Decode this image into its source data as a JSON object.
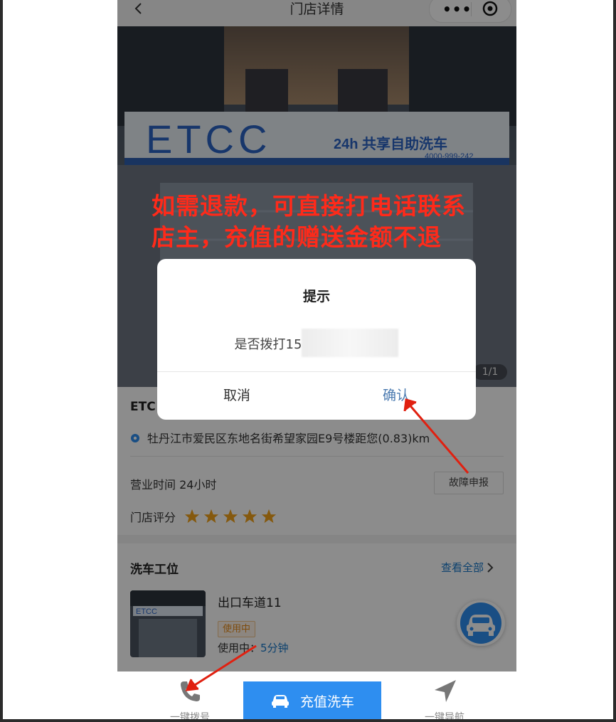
{
  "nav": {
    "title": "门店详情",
    "more_glyph": "•••"
  },
  "banner": {
    "sign_brand": "ETCC",
    "sign_slogan": "24h 共享自助洗车",
    "sign_phone": "4000-999-242",
    "counter": "1/1"
  },
  "annotation": {
    "line1": "如需退款，可直接打电话联系",
    "line2": "店主，充值的赠送金额不退"
  },
  "dialog": {
    "title": "提示",
    "message": "是否拨打15",
    "cancel": "取消",
    "confirm": "确认"
  },
  "store": {
    "name": "ETC",
    "address": "牡丹江市爱民区东地名街希望家园E9号楼距您(0.83)km",
    "hours_label": "营业时间",
    "hours_value": "24小时",
    "fault_button": "故障申报",
    "rating_label": "门店评分",
    "rating": 5
  },
  "bays": {
    "title": "洗车工位",
    "view_all": "查看全部",
    "items": [
      {
        "name": "出口车道11",
        "status": "使用中",
        "usage_label": "使用中：",
        "usage_value": "5分钟"
      }
    ]
  },
  "bottom": {
    "call": "一键拨号",
    "recharge": "充值洗车",
    "navigate": "一键导航"
  },
  "colors": {
    "accent": "#2e8ef0",
    "link": "#1677c8",
    "annotation": "#ff2a1a",
    "star": "#f3a21a"
  }
}
